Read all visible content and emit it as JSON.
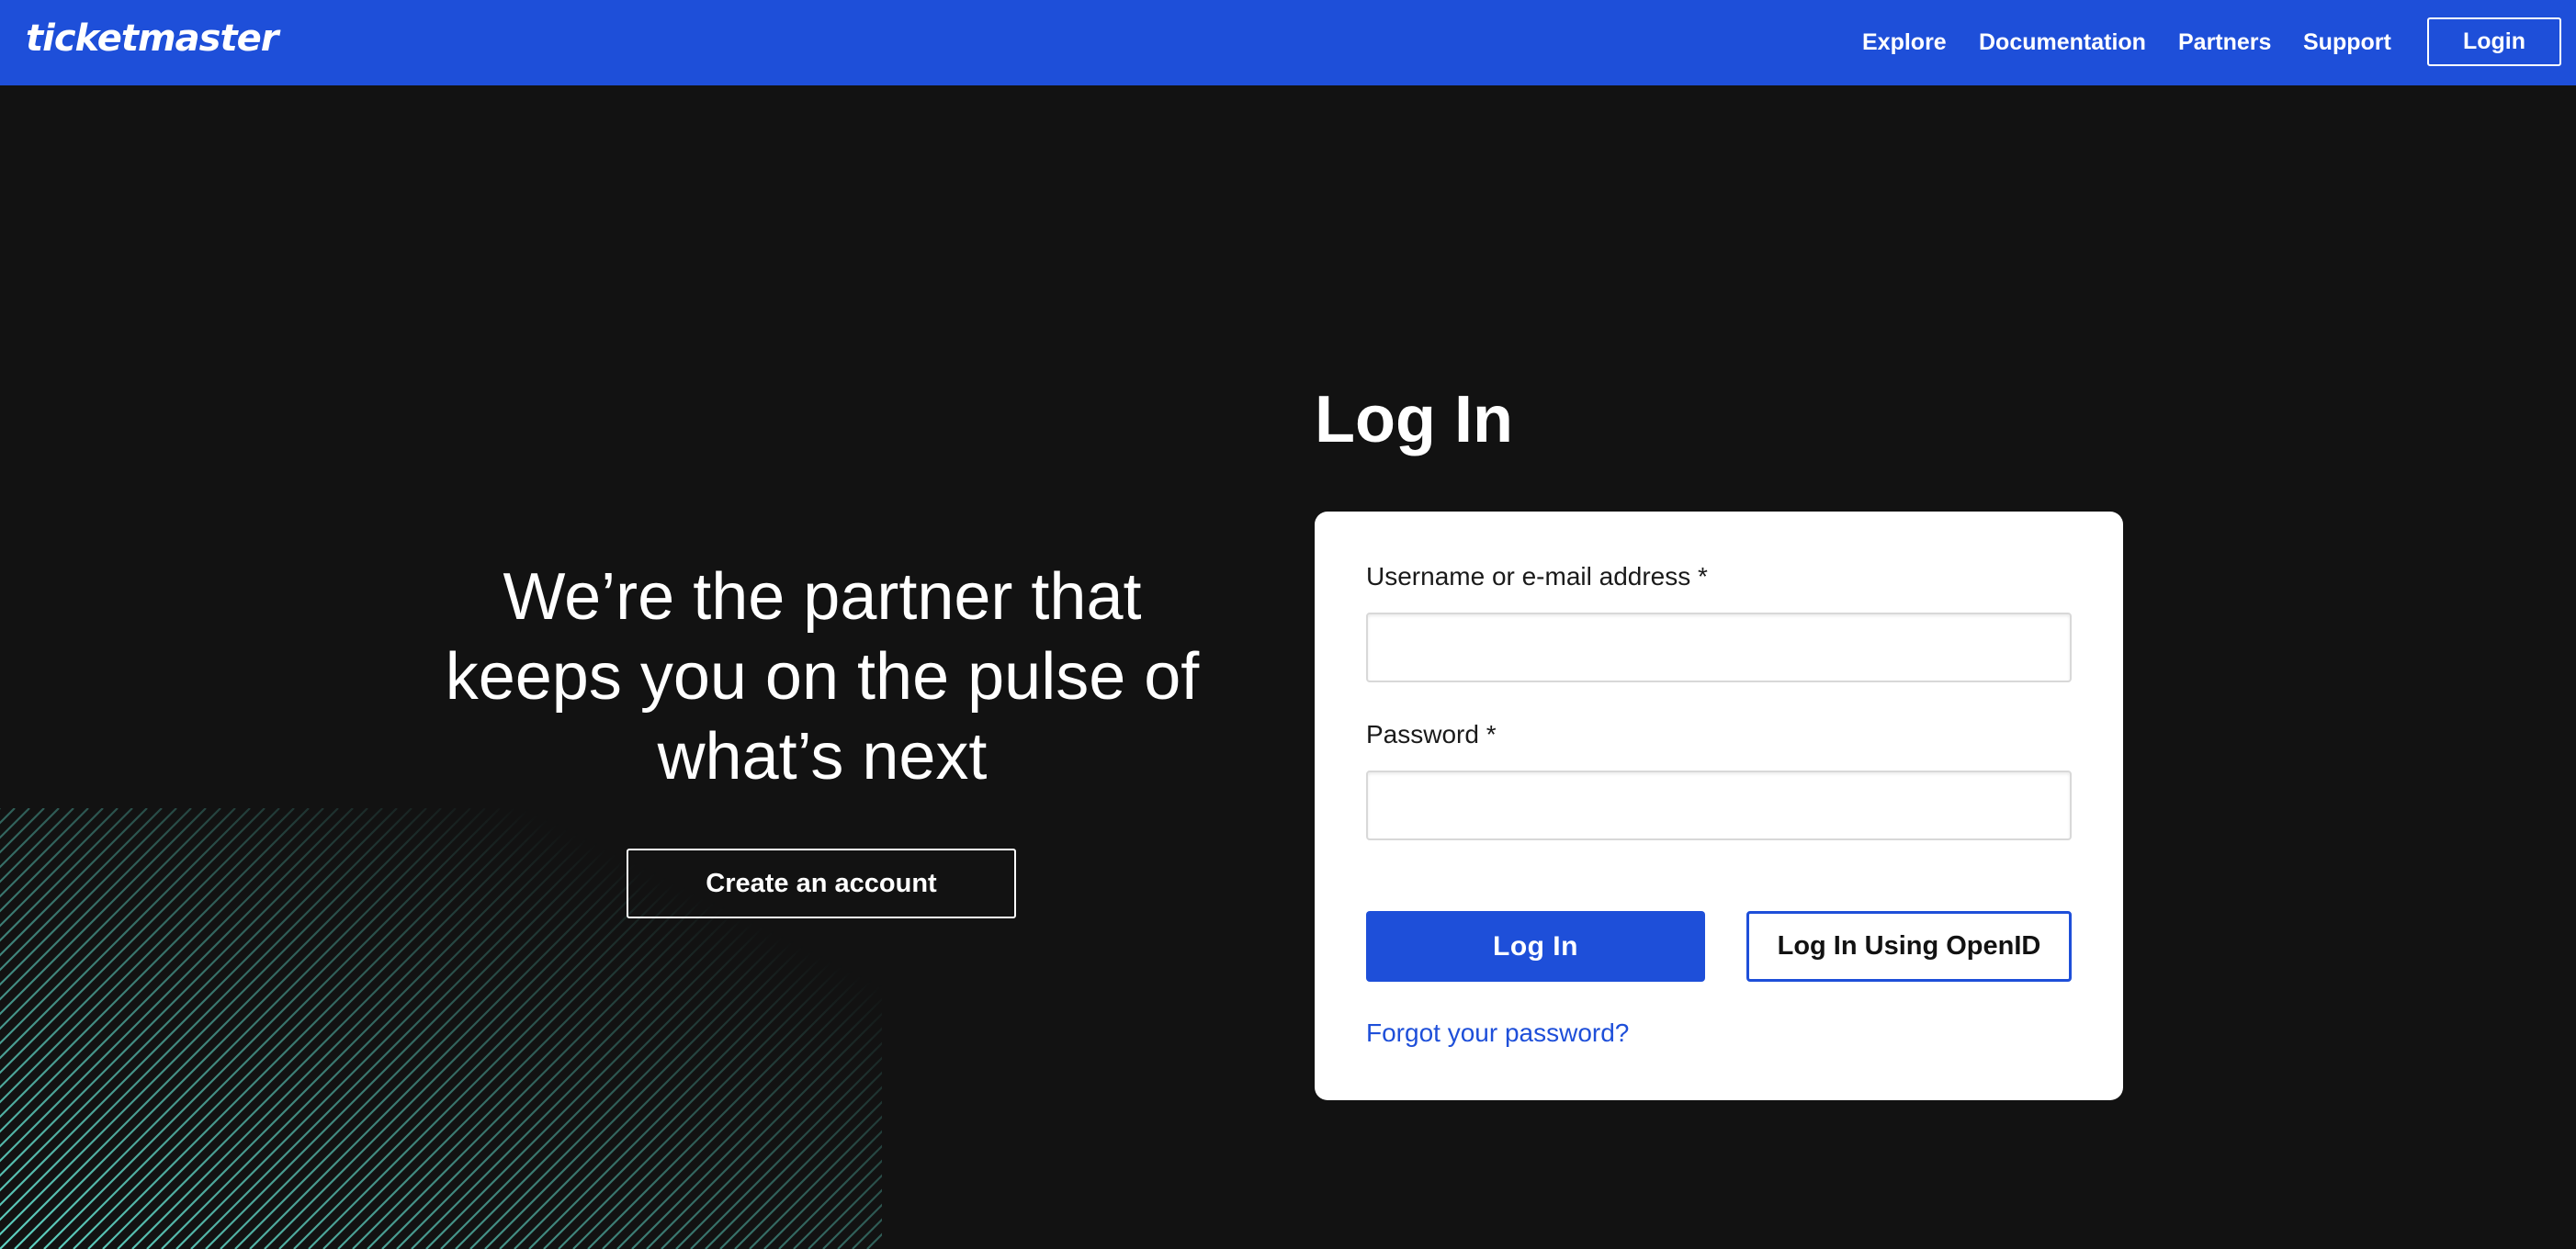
{
  "header": {
    "logo_text": "ticketmaster",
    "nav": [
      {
        "label": "Explore"
      },
      {
        "label": "Documentation"
      },
      {
        "label": "Partners"
      },
      {
        "label": "Support"
      }
    ],
    "login_label": "Login",
    "bar_color": "#1e4fd9"
  },
  "hero": {
    "tagline_line1": "We’re the partner that",
    "tagline_line2": "keeps you on the pulse of",
    "tagline_line3": "what’s next",
    "create_account_label": "Create an account",
    "stripe_color": "#5fd4c4"
  },
  "login": {
    "title": "Log In",
    "username_label": "Username or e-mail address *",
    "username_value": "",
    "password_label": "Password *",
    "password_value": "",
    "submit_label": "Log In",
    "openid_label": "Log In Using OpenID",
    "forgot_label": "Forgot your password?"
  }
}
